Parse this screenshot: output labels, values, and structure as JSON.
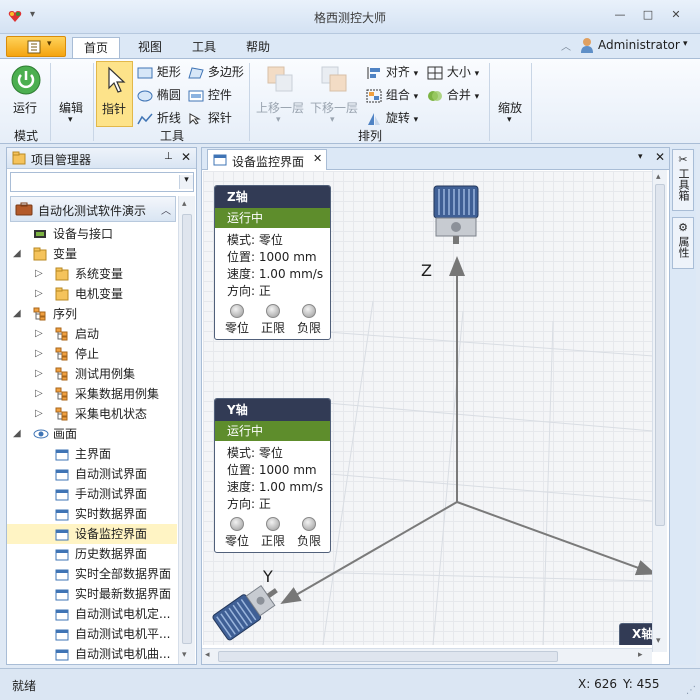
{
  "titlebar": {
    "title": "格西测控大师",
    "min": "—",
    "max": "□",
    "close": "✕"
  },
  "ribbon_tabs": [
    {
      "label": "首页",
      "active": true
    },
    {
      "label": "视图",
      "active": false
    },
    {
      "label": "工具",
      "active": false
    },
    {
      "label": "帮助",
      "active": false
    }
  ],
  "user": {
    "name": "Administrator"
  },
  "ribbon": {
    "run": "运行",
    "edit": "编辑",
    "pointer": "指针",
    "rectangle": "矩形",
    "ellipse": "椭圆",
    "polyline": "折线",
    "polygon": "多边形",
    "control": "控件",
    "probe": "探针",
    "bring_up": "上移一层",
    "send_down": "下移一层",
    "align": "对齐",
    "group": "组合",
    "rotate": "旋转",
    "size": "大小",
    "merge": "合并",
    "zoom": "缩放",
    "groups": {
      "mode": "模式",
      "tools": "工具",
      "arrange": "排列"
    }
  },
  "project_panel": {
    "title": "项目管理器",
    "root": "自动化测试软件演示",
    "items": [
      {
        "label": "设备与接口",
        "level": 0,
        "expander": "",
        "icon": "device"
      },
      {
        "label": "变量",
        "level": 0,
        "expander": "open",
        "icon": "folder"
      },
      {
        "label": "系统变量",
        "level": 1,
        "expander": "closed",
        "icon": "folder"
      },
      {
        "label": "电机变量",
        "level": 1,
        "expander": "closed",
        "icon": "folder"
      },
      {
        "label": "序列",
        "level": 0,
        "expander": "open",
        "icon": "sequence"
      },
      {
        "label": "启动",
        "level": 1,
        "expander": "closed",
        "icon": "sequence"
      },
      {
        "label": "停止",
        "level": 1,
        "expander": "closed",
        "icon": "sequence"
      },
      {
        "label": "测试用例集",
        "level": 1,
        "expander": "closed",
        "icon": "sequence"
      },
      {
        "label": "采集数据用例集",
        "level": 1,
        "expander": "closed",
        "icon": "sequence"
      },
      {
        "label": "采集电机状态",
        "level": 1,
        "expander": "closed",
        "icon": "sequence"
      },
      {
        "label": "画面",
        "level": 0,
        "expander": "open",
        "icon": "eye"
      },
      {
        "label": "主界面",
        "level": 1,
        "expander": "",
        "icon": "screen"
      },
      {
        "label": "自动测试界面",
        "level": 1,
        "expander": "",
        "icon": "screen"
      },
      {
        "label": "手动测试界面",
        "level": 1,
        "expander": "",
        "icon": "screen"
      },
      {
        "label": "实时数据界面",
        "level": 1,
        "expander": "",
        "icon": "screen"
      },
      {
        "label": "设备监控界面",
        "level": 1,
        "expander": "",
        "icon": "screen",
        "selected": true
      },
      {
        "label": "历史数据界面",
        "level": 1,
        "expander": "",
        "icon": "screen"
      },
      {
        "label": "实时全部数据界面",
        "level": 1,
        "expander": "",
        "icon": "screen"
      },
      {
        "label": "实时最新数据界面",
        "level": 1,
        "expander": "",
        "icon": "screen"
      },
      {
        "label": "自动测试电机定...",
        "level": 1,
        "expander": "",
        "icon": "screen"
      },
      {
        "label": "自动测试电机平...",
        "level": 1,
        "expander": "",
        "icon": "screen"
      },
      {
        "label": "自动测试电机曲...",
        "level": 1,
        "expander": "",
        "icon": "screen"
      }
    ]
  },
  "document": {
    "tab": "设备监控界面"
  },
  "cards": [
    {
      "id": "z",
      "title": "Z轴",
      "status": "运行中",
      "mode": "模式: 零位",
      "position": "位置: 1000 mm",
      "speed": "速度: 1.00  mm/s",
      "direction": "方向: 正",
      "lamps": [
        "零位",
        "正限",
        "负限"
      ]
    },
    {
      "id": "y",
      "title": "Y轴",
      "status": "运行中",
      "mode": "模式: 零位",
      "position": "位置: 1000 mm",
      "speed": "速度: 1.00  mm/s",
      "direction": "方向: 正",
      "lamps": [
        "零位",
        "正限",
        "负限"
      ]
    }
  ],
  "x_card_title": "X轴",
  "axes_labels": {
    "z": "Z",
    "y": "Y"
  },
  "right_dock": {
    "toolbox": "工具箱",
    "properties": "属性"
  },
  "status": {
    "text": "就绪",
    "x": "X: 626",
    "y": "Y: 455"
  },
  "colors": {
    "card_header": "#323b55",
    "status_green": "#5e8d2c",
    "accent": "#f4a410"
  }
}
